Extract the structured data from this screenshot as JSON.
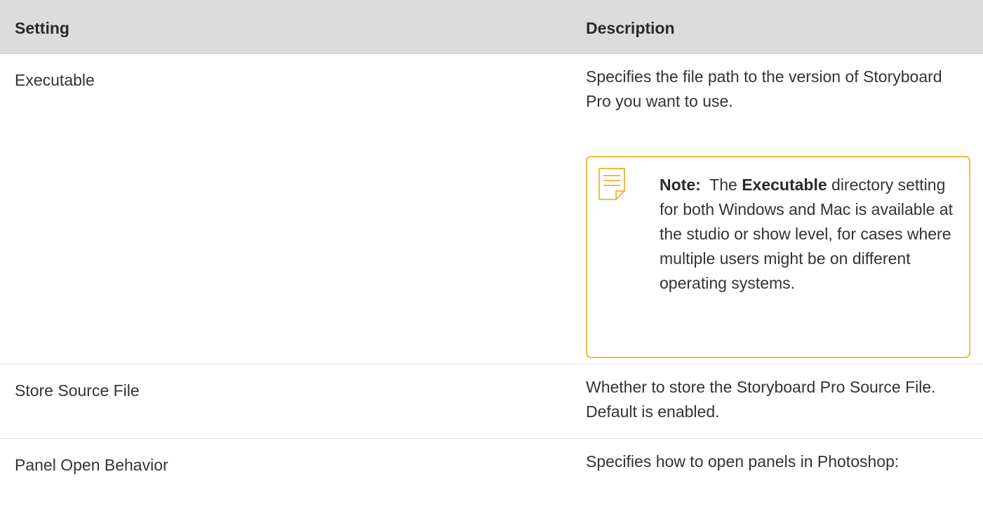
{
  "table": {
    "headers": {
      "setting": "Setting",
      "description": "Description"
    },
    "rows": [
      {
        "setting": "Executable",
        "description": "Specifies the file path to the version of Storyboard Pro you want to use.",
        "note": {
          "label": "Note:",
          "pre": "The",
          "emphasis": "Executable",
          "post": "directory setting for both Windows and Mac is available at the studio or show level, for cases where multiple users might be on different operating systems."
        }
      },
      {
        "setting": "Store Source File",
        "description": "Whether to store the Storyboard Pro Source File. Default is enabled."
      },
      {
        "setting": "Panel Open Behavior",
        "description": "Specifies how to open panels in Photoshop:"
      }
    ]
  },
  "colors": {
    "header_background": "#dcdcdc",
    "note_border": "#f5b942",
    "text": "#333333"
  },
  "icons": {
    "note": "note-icon"
  }
}
